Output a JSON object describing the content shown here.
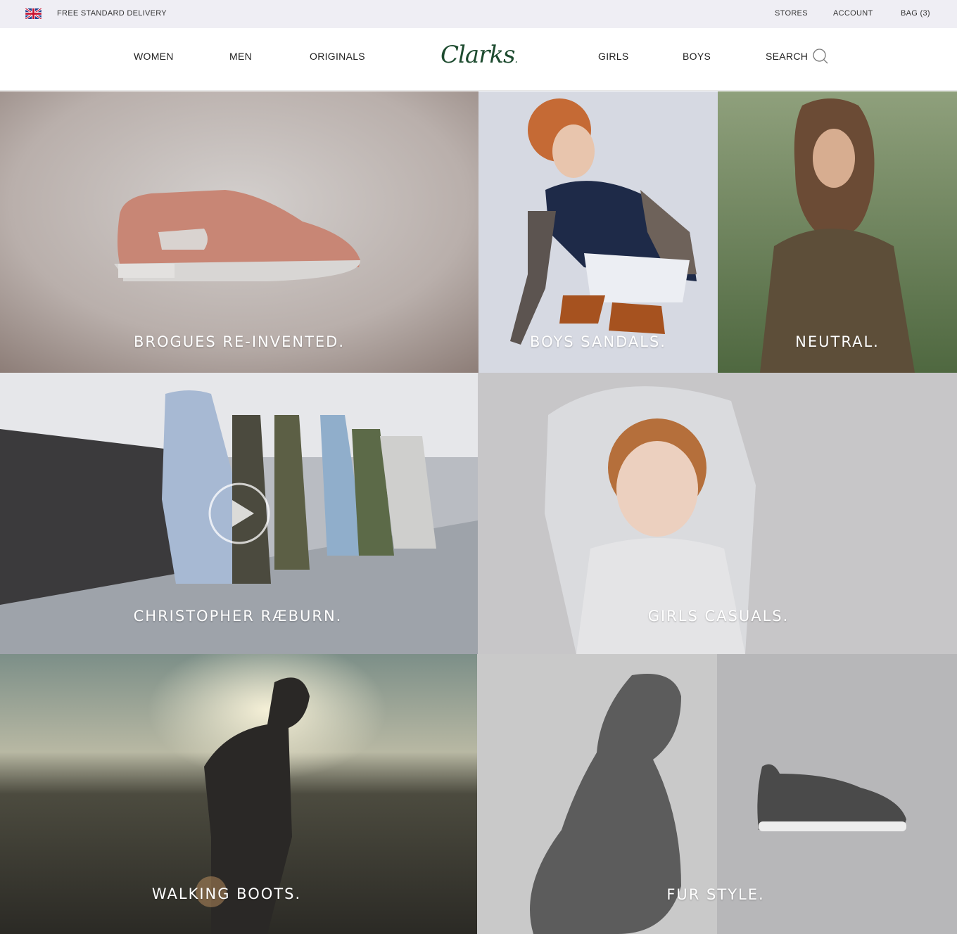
{
  "utility_bar": {
    "flag_icon": "uk-flag-icon",
    "delivery_text": "FREE STANDARD DELIVERY",
    "stores": "STORES",
    "account": "ACCOUNT",
    "bag": "BAG (3)"
  },
  "nav": {
    "women": "WOMEN",
    "men": "MEN",
    "originals": "ORIGINALS",
    "logo": "Clarks",
    "girls": "GIRLS",
    "boys": "BOYS",
    "search": "SEARCH",
    "search_icon": "search-icon"
  },
  "tiles": {
    "brogues": "BROGUES RE-INVENTED.",
    "boys_sandals": "BOYS SANDALS.",
    "neutral": "NEUTRAL.",
    "raeburn": "CHRISTOPHER RÆBURN.",
    "girls_casuals": "GIRLS CASUALS.",
    "walking_boots": "WALKING BOOTS.",
    "fur_style": "FUR STYLE."
  },
  "colors": {
    "utility_bg": "#efeef4",
    "logo_green": "#1d4b2f",
    "caption_text": "#ffffff"
  }
}
